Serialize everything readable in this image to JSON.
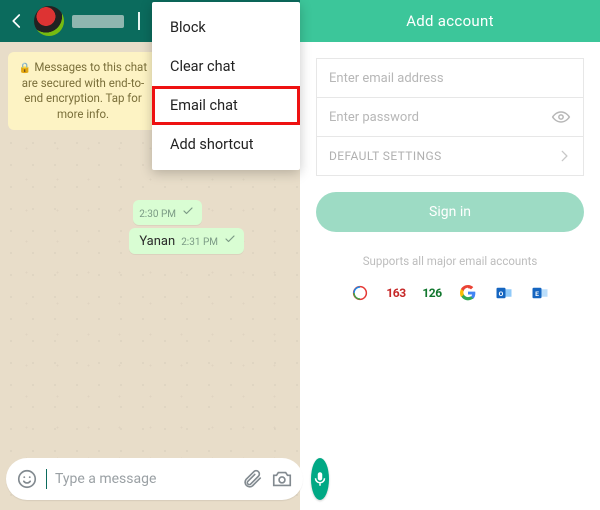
{
  "wa": {
    "encryption_notice": "Messages to this chat are secured with end-to-end encryption. Tap for more info.",
    "menu": {
      "block": "Block",
      "clear_chat": "Clear chat",
      "email_chat": "Email chat",
      "add_shortcut": "Add shortcut"
    },
    "messages": {
      "m1": {
        "time": "2:30 PM"
      },
      "m2": {
        "text": "Yanan",
        "time": "2:31 PM"
      }
    },
    "input": {
      "placeholder": "Type a message"
    }
  },
  "mail": {
    "title": "Add account",
    "email_placeholder": "Enter email address",
    "password_placeholder": "Enter password",
    "default_settings": "DEFAULT SETTINGS",
    "signin": "Sign in",
    "supports": "Supports all major email accounts",
    "providers": {
      "p163": "163",
      "p126": "126"
    }
  }
}
